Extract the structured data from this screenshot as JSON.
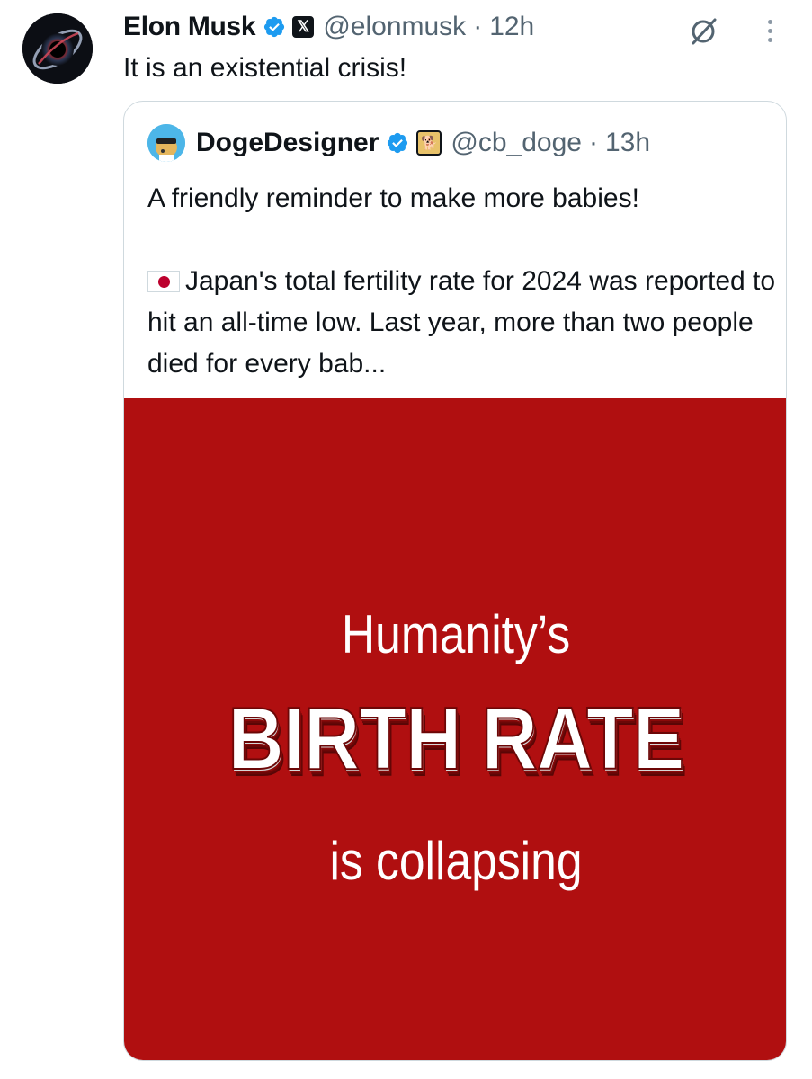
{
  "tweet": {
    "author_name": "Elon Musk",
    "handle": "@elonmusk",
    "separator": "·",
    "time": "12h",
    "text": "It is an existential crisis!",
    "avatar_icon": "black-hole-avatar",
    "grok_icon": "grok-icon",
    "more_icon": "more-options-icon"
  },
  "quoted": {
    "author_name": "DogeDesigner",
    "handle": "@cb_doge",
    "separator": "·",
    "time": "13h",
    "line1": "A friendly reminder to make more babies!",
    "paragraph": "Japan's total fertility rate for 2024 was reported to hit an all-time low. Last year, more than two people died for every bab...",
    "media": {
      "line1": "Humanity’s",
      "line2": "BIRTH RATE",
      "line3": "is collapsing",
      "background": "#b00f10"
    }
  },
  "colors": {
    "verified": "#1d9bf0",
    "muted_text": "#536471",
    "text": "#0f1419"
  }
}
